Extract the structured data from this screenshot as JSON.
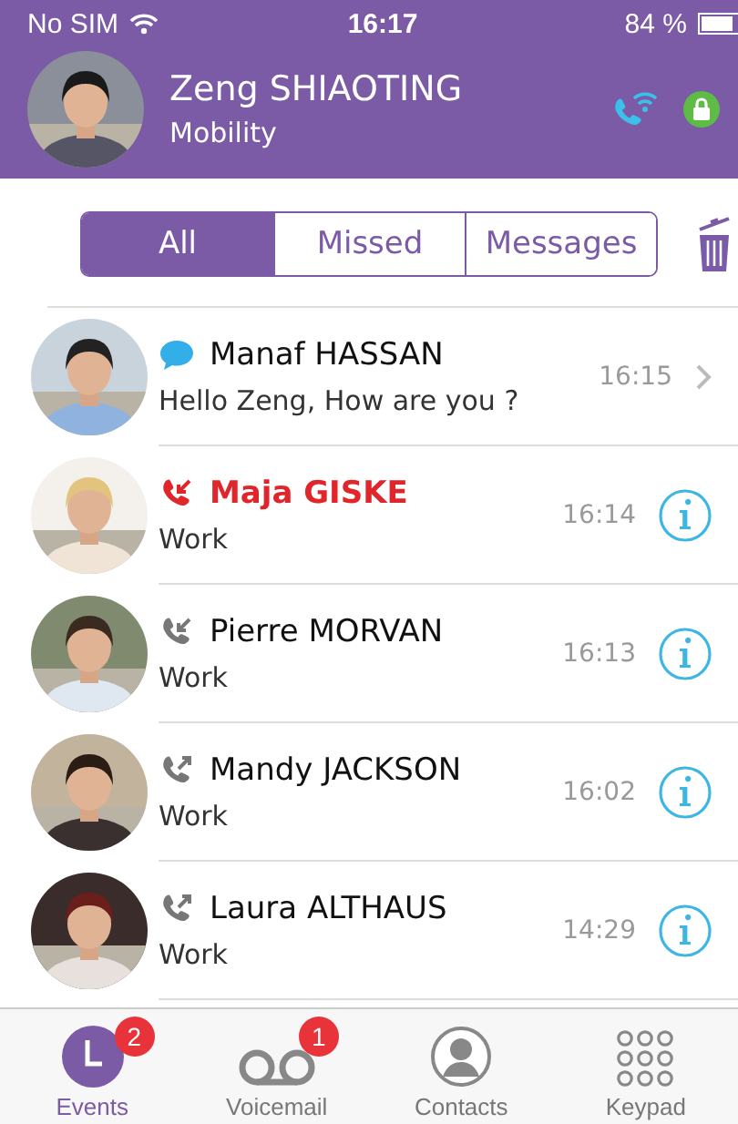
{
  "status_bar": {
    "carrier": "No SIM",
    "time": "16:17",
    "battery": "84 %"
  },
  "header": {
    "name": "Zeng SHIAOTING",
    "subtitle": "Mobility"
  },
  "filters": [
    {
      "label": "All",
      "selected": true
    },
    {
      "label": "Missed",
      "selected": false
    },
    {
      "label": "Messages",
      "selected": false
    }
  ],
  "events": [
    {
      "kind": "message",
      "name": "Manaf HASSAN",
      "detail": "Hello Zeng, How are you ?",
      "time": "16:15",
      "info_button": false
    },
    {
      "kind": "missed",
      "name": "Maja GISKE",
      "detail": "Work",
      "time": "16:14",
      "info_button": true
    },
    {
      "kind": "incoming",
      "name": "Pierre MORVAN",
      "detail": "Work",
      "time": "16:13",
      "info_button": true
    },
    {
      "kind": "outgoing",
      "name": "Mandy JACKSON",
      "detail": "Work",
      "time": "16:02",
      "info_button": true
    },
    {
      "kind": "outgoing",
      "name": "Laura ALTHAUS",
      "detail": "Work",
      "time": "14:29",
      "info_button": true
    }
  ],
  "tab_bar": [
    {
      "label": "Events",
      "selected": true,
      "badge": "2"
    },
    {
      "label": "Voicemail",
      "selected": false,
      "badge": "1"
    },
    {
      "label": "Contacts",
      "selected": false
    },
    {
      "label": "Keypad",
      "selected": false
    }
  ]
}
